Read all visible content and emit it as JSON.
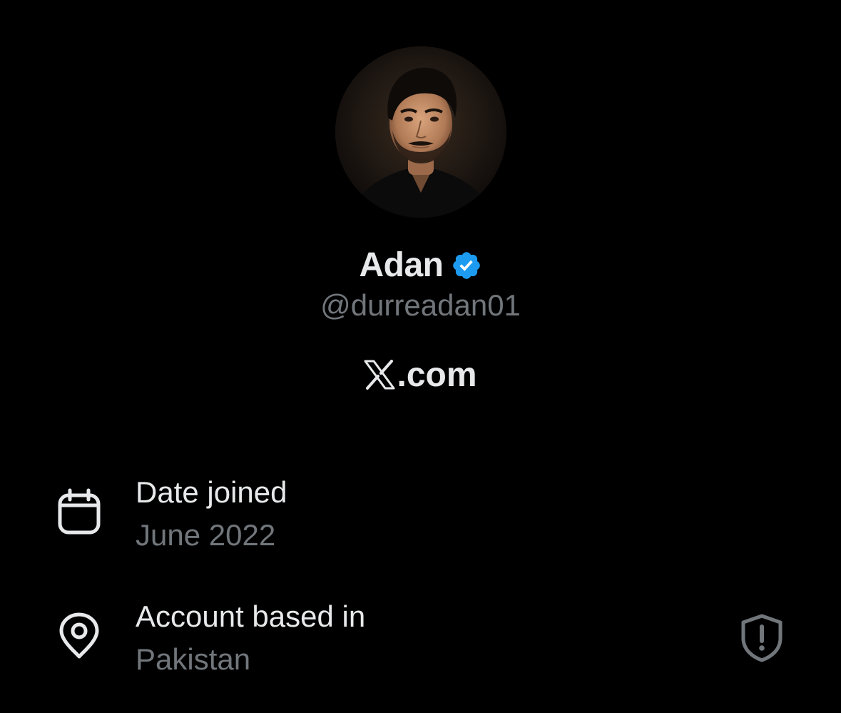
{
  "profile": {
    "display_name": "Adan",
    "handle": "@durreadan01",
    "verified": true,
    "avatar_icon": "profile-photo",
    "verified_icon": "verified-badge-icon",
    "verified_color": "#1d9bf0"
  },
  "source": {
    "logo_icon": "x-logo-icon",
    "suffix": ".com"
  },
  "details": {
    "date_joined": {
      "icon": "calendar-icon",
      "label": "Date joined",
      "value": "June 2022"
    },
    "location": {
      "icon": "location-pin-icon",
      "label": "Account based in",
      "value": "Pakistan",
      "alert_icon": "shield-alert-icon"
    }
  },
  "colors": {
    "background": "#000000",
    "primary_text": "#e7e9ea",
    "secondary_text": "#71767b"
  }
}
